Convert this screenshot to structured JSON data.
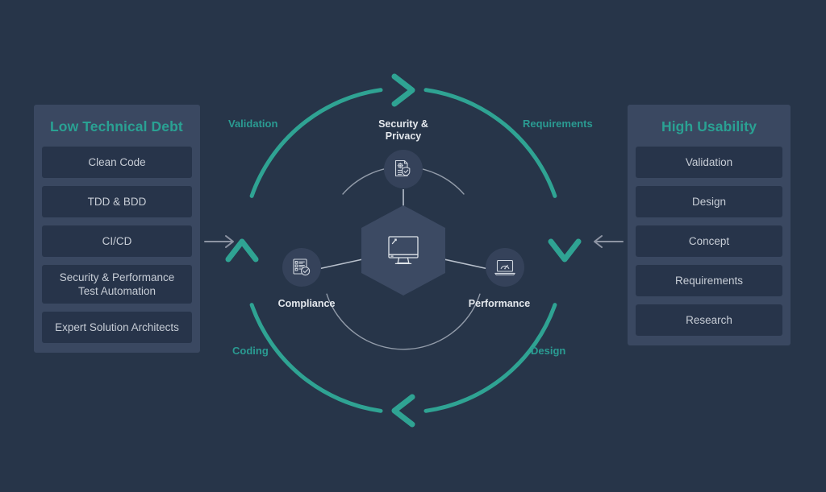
{
  "theme": {
    "background": "#273549",
    "panel_bg": "#3a4861",
    "item_bg": "#27344a",
    "accent_teal": "#2aa193",
    "ring_teal": "#2fa393",
    "text_light": "#c7cdd6",
    "text_bright": "#e4e8ed",
    "inner_arc": "#9aa3b0",
    "gray_arrow": "#8d94a3"
  },
  "left_panel": {
    "title": "Low Technical Debt",
    "items": [
      {
        "label": "Clean Code"
      },
      {
        "label": "TDD & BDD"
      },
      {
        "label": "CI/CD"
      },
      {
        "label": "Security & Performance Test Automation"
      },
      {
        "label": "Expert Solution Architects"
      }
    ]
  },
  "right_panel": {
    "title": "High Usability",
    "items": [
      {
        "label": "Validation"
      },
      {
        "label": "Design"
      },
      {
        "label": "Concept"
      },
      {
        "label": "Requirements"
      },
      {
        "label": "Research"
      }
    ]
  },
  "cycle": {
    "ring_labels": {
      "top_left": "Validation",
      "top_right": "Requirements",
      "bottom_left": "Coding",
      "bottom_right": "Design"
    },
    "chevrons": [
      {
        "name": "chevron-top",
        "direction": "right"
      },
      {
        "name": "chevron-right",
        "direction": "down"
      },
      {
        "name": "chevron-bottom",
        "direction": "left"
      },
      {
        "name": "chevron-left",
        "direction": "up"
      }
    ],
    "nodes": [
      {
        "label": "Security &\nPrivacy",
        "line1": "Security &",
        "line2": "Privacy",
        "icon": "document-gear-shield-icon"
      },
      {
        "label": "Compliance",
        "icon": "checklist-check-icon"
      },
      {
        "label": "Performance",
        "icon": "laptop-gauge-icon"
      }
    ],
    "center": {
      "icon": "desktop-monitor-icon"
    },
    "inflow_arrow": "arrow-right-icon",
    "outflow_arrow": "arrow-left-icon"
  }
}
